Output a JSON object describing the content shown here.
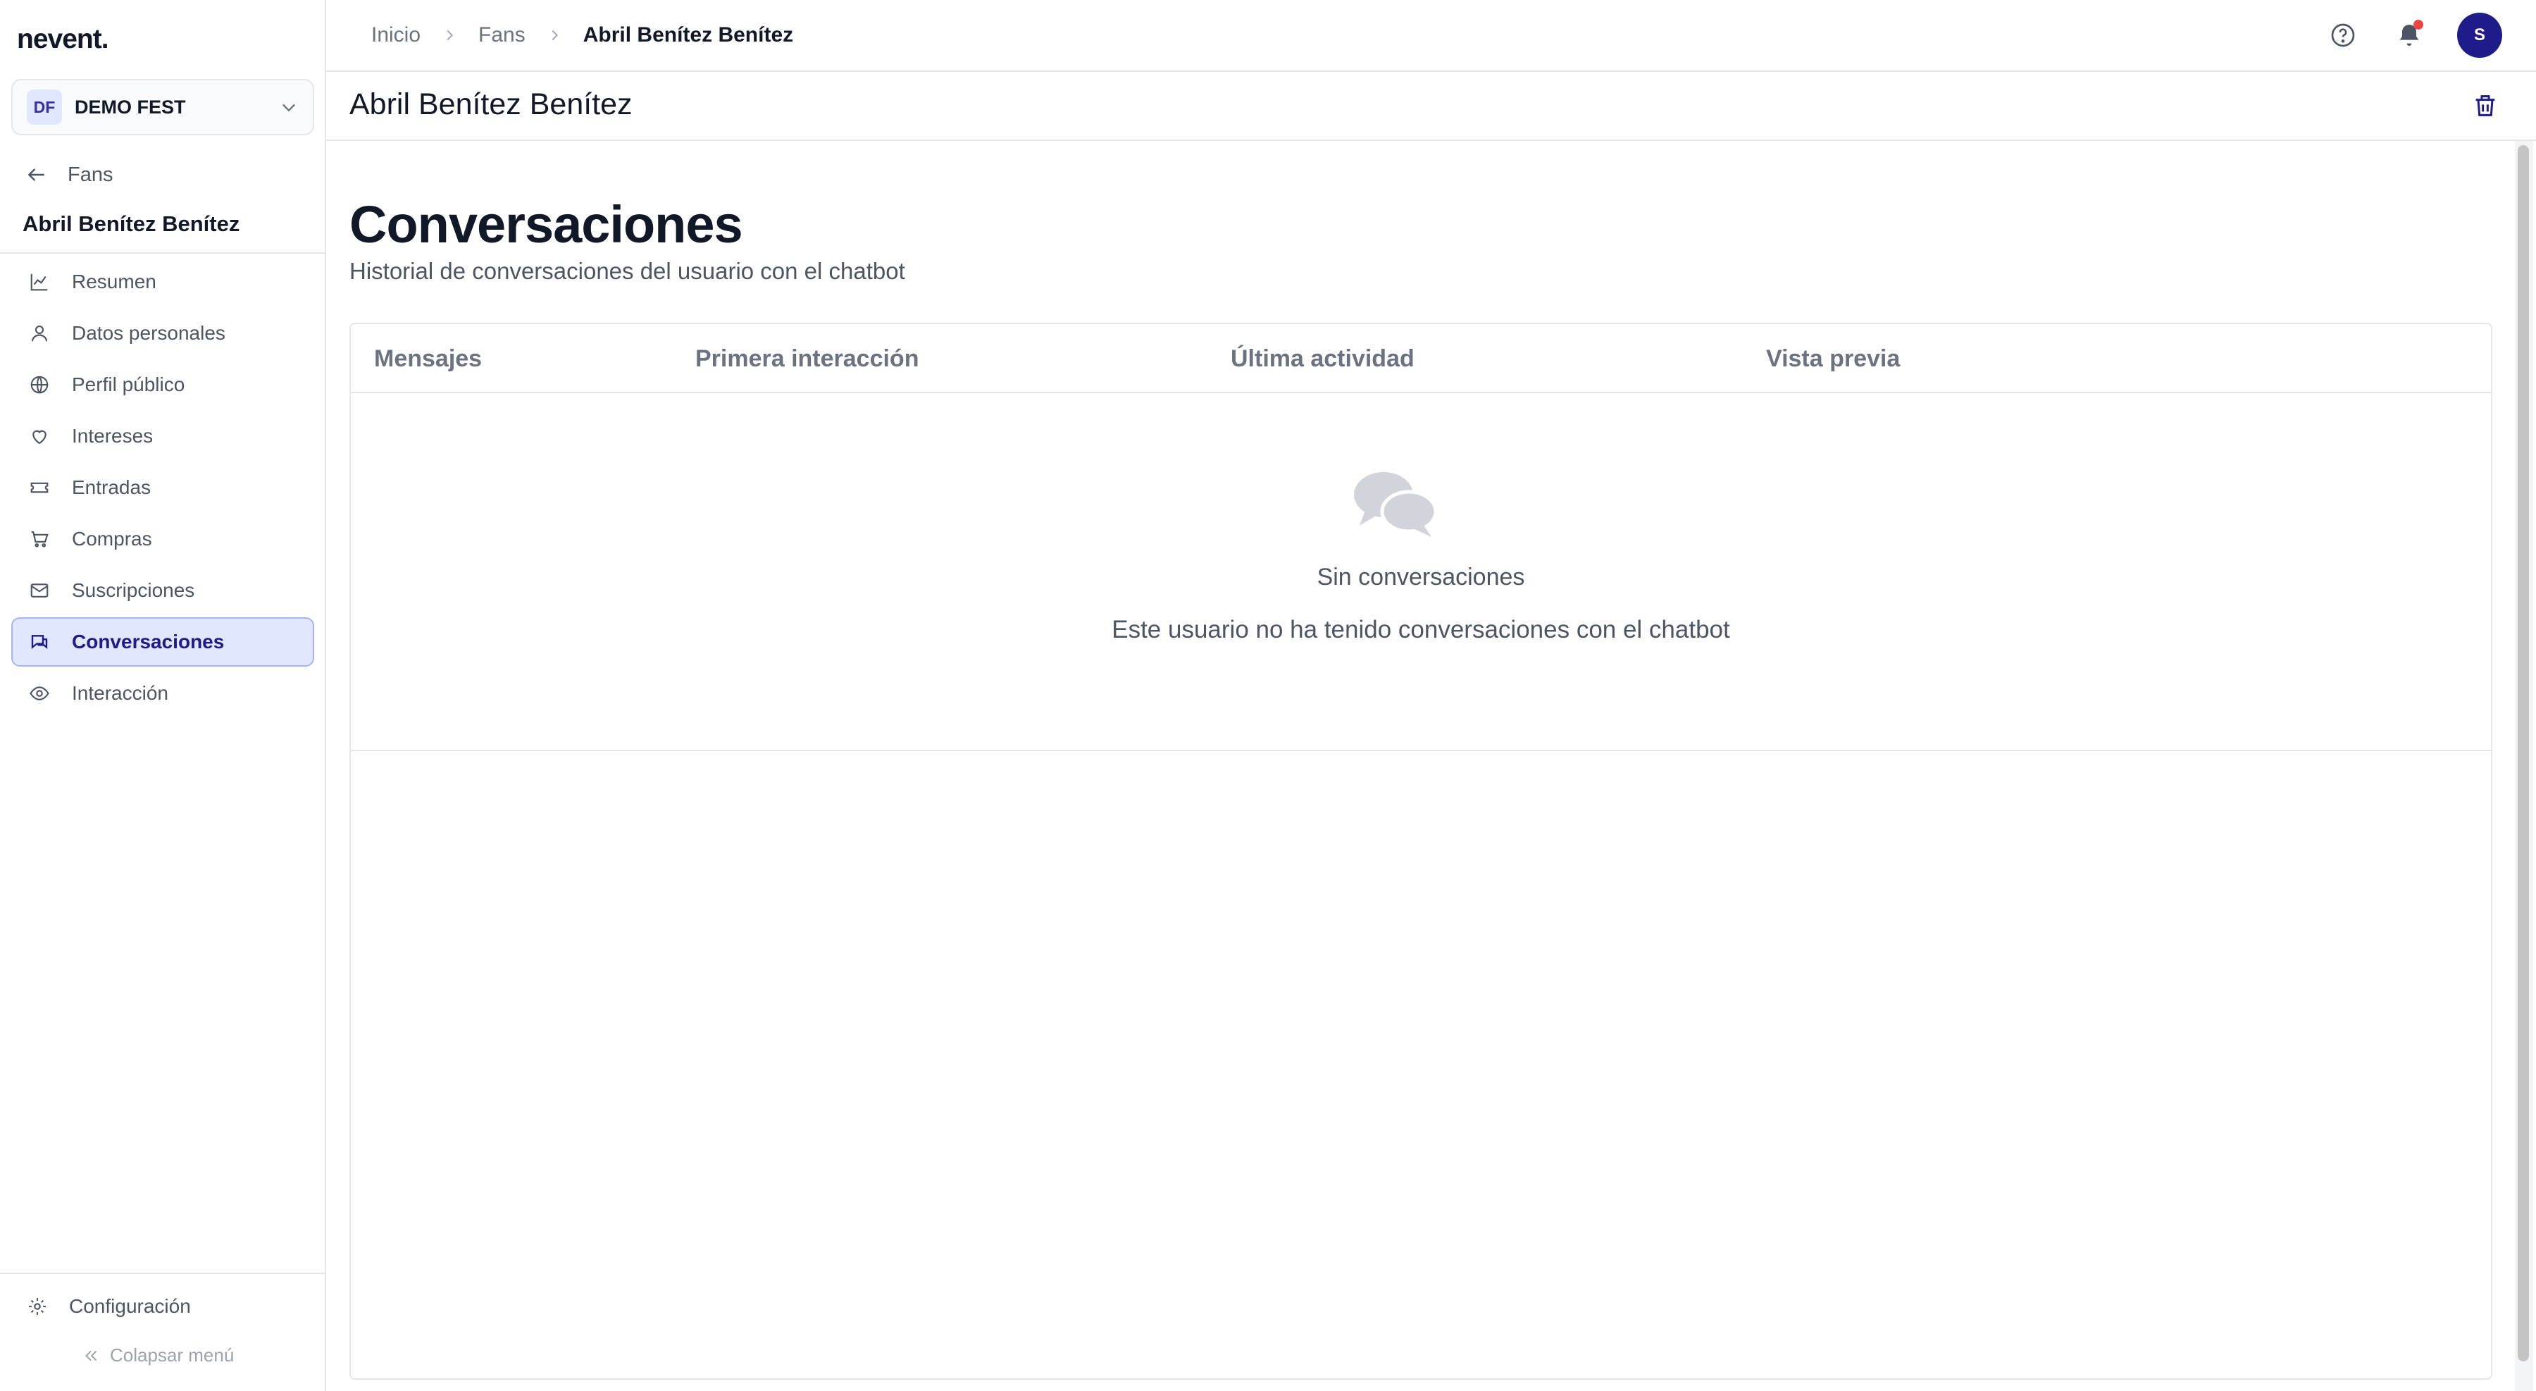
{
  "app": {
    "logo": "nevent."
  },
  "org": {
    "initials": "DF",
    "name": "DEMO FEST"
  },
  "sidebar": {
    "back_label": "Fans",
    "fan_name": "Abril Benítez Benítez",
    "items": [
      {
        "label": "Resumen",
        "icon": "chart-line-icon"
      },
      {
        "label": "Datos personales",
        "icon": "user-icon"
      },
      {
        "label": "Perfil público",
        "icon": "globe-icon"
      },
      {
        "label": "Intereses",
        "icon": "heart-icon"
      },
      {
        "label": "Entradas",
        "icon": "ticket-icon"
      },
      {
        "label": "Compras",
        "icon": "cart-icon"
      },
      {
        "label": "Suscripciones",
        "icon": "mail-icon"
      },
      {
        "label": "Conversaciones",
        "icon": "chat-icon",
        "active": true
      },
      {
        "label": "Interacción",
        "icon": "eye-icon"
      }
    ],
    "config_label": "Configuración",
    "collapse_label": "Colapsar menú"
  },
  "breadcrumb": {
    "items": [
      "Inicio",
      "Fans",
      "Abril Benítez Benítez"
    ]
  },
  "topbar": {
    "avatar_initial": "S"
  },
  "page": {
    "title": "Abril Benítez Benítez"
  },
  "section": {
    "title": "Conversaciones",
    "subtitle": "Historial de conversaciones del usuario con el chatbot"
  },
  "table": {
    "columns": [
      "Mensajes",
      "Primera interacción",
      "Última actividad",
      "Vista previa"
    ],
    "empty_title": "Sin conversaciones",
    "empty_text": "Este usuario no ha tenido conversaciones con el chatbot"
  },
  "colors": {
    "accent": "#1e1b8a",
    "active_bg": "#e0e7ff",
    "notification": "#ef4444"
  }
}
